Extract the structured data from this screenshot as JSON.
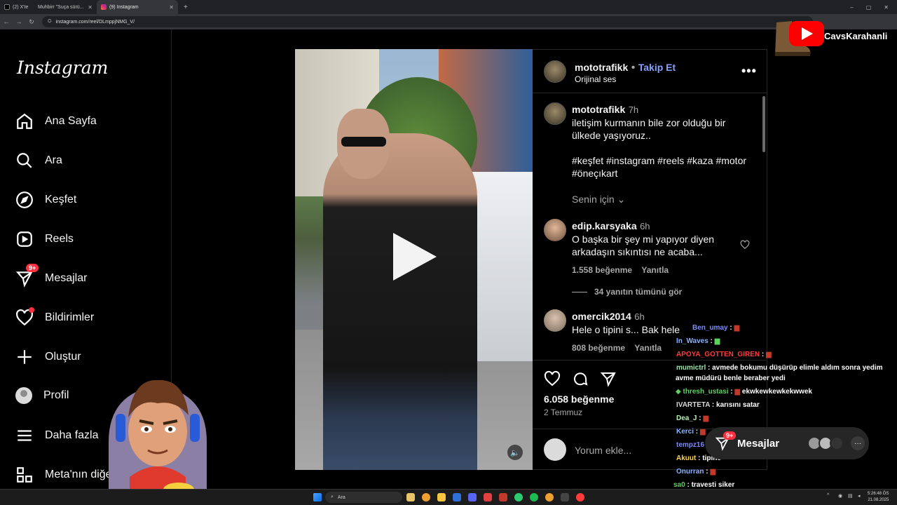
{
  "browser": {
    "tabs": [
      {
        "label": "(2) X'te"
      },
      {
        "label": "Muhbirr \"Suça sürü..."
      },
      {
        "label": "(9) Instagram"
      }
    ],
    "url": "instagram.com/reel/DLmppjNMG_V/"
  },
  "brand": {
    "logo": "Instagram"
  },
  "sidebar": {
    "items": [
      {
        "label": "Ana Sayfa",
        "icon": "home-icon"
      },
      {
        "label": "Ara",
        "icon": "search-icon"
      },
      {
        "label": "Keşfet",
        "icon": "compass-icon"
      },
      {
        "label": "Reels",
        "icon": "reels-icon"
      },
      {
        "label": "Mesajlar",
        "icon": "messenger-icon",
        "badge": "9+"
      },
      {
        "label": "Bildirimler",
        "icon": "heart-icon"
      },
      {
        "label": "Oluştur",
        "icon": "plus-icon"
      },
      {
        "label": "Profil",
        "icon": "profile-icon"
      },
      {
        "label": "Daha fazla",
        "icon": "menu-icon"
      },
      {
        "label": "Meta'nın diğe",
        "icon": "meta-apps-icon"
      }
    ]
  },
  "post": {
    "author": "mototrafikk",
    "follow_label": "Takip Et",
    "separator": "•",
    "audio": "Orijinal ses",
    "caption": {
      "author": "mototrafikk",
      "time": "7h",
      "text": "iletişim kurmanın bile zor olduğu bir ülkede yaşıyoruz..",
      "hashtags": "#keşfet #instagram #reels #kaza #motor #öneçıkart"
    },
    "sort_label": "Senin için",
    "comments": [
      {
        "author": "edip.karsyaka",
        "time": "6h",
        "text": "O başka bir şey mi yapıyor diyen arkadaşın sıkıntısı ne acaba...",
        "likes": "1.558 beğenme",
        "reply": "Yanıtla",
        "view_replies": "34 yanıtın tümünü gör"
      },
      {
        "author": "omercik2014",
        "time": "6h",
        "text": "Hele o tipini s... Bak hele",
        "likes": "808 beğenme",
        "reply": "Yanıtla"
      }
    ],
    "likes": "6.058 beğenme",
    "date": "2 Temmuz",
    "comment_placeholder": "Yorum ekle..."
  },
  "chat": [
    {
      "user": "Ben_umay",
      "color": "#7a8cff",
      "text": ""
    },
    {
      "user": "In_Waves",
      "color": "#8ab4ff",
      "text": ""
    },
    {
      "user": "APOYA_GOTTEN_GIREN",
      "color": "#ff3b3b",
      "text": ""
    },
    {
      "user": "mumictrl",
      "color": "#9fe3a8",
      "text": "avmede bokumu düşürüp elimle aldım sonra yedim"
    },
    {
      "user": "",
      "color": "#ffffff",
      "text": "avme müdürü benle beraber yedi"
    },
    {
      "user": "thresh_ustasi",
      "color": "#5fd15f",
      "text": "ekwkewkewkekwwek"
    },
    {
      "user": "IVARTETA",
      "color": "#d9d9d9",
      "text": "karısını satar"
    },
    {
      "user": "Dea_J",
      "color": "#b6f0b6",
      "text": ""
    },
    {
      "user": "Kerci",
      "color": "#8ab4ff",
      "text": ""
    },
    {
      "user": "tempz16",
      "color": "#7a8cff",
      "text": ""
    },
    {
      "user": "Akuut",
      "color": "#ffd24a",
      "text": "tipine"
    },
    {
      "user": "Onurran",
      "color": "#8ab4ff",
      "text": ""
    },
    {
      "user": "sa0",
      "color": "#5fd15f",
      "text": "travesti siker"
    }
  ],
  "messages_float": {
    "label": "Mesajlar",
    "badge": "9+"
  },
  "youtube": {
    "channel": "CavsKarahanli"
  },
  "taskbar": {
    "search": "Ara",
    "time": "5:26:48 ÖS",
    "date": "21.08.2025"
  },
  "colors": {
    "accent": "#85a1ff",
    "badge": "#ff3040",
    "background": "#000000"
  }
}
